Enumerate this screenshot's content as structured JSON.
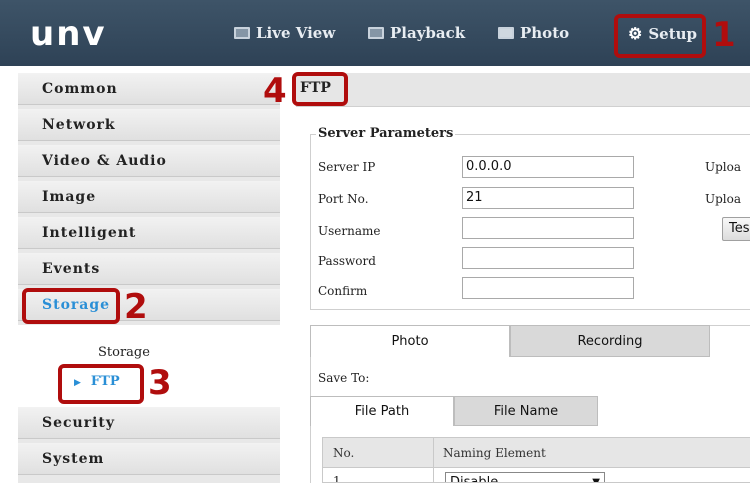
{
  "nav": {
    "logo": "unv",
    "items": [
      {
        "label": "Live View",
        "icon": "monitor-icon"
      },
      {
        "label": "Playback",
        "icon": "film-icon"
      },
      {
        "label": "Photo",
        "icon": "image-icon"
      },
      {
        "label": "Setup",
        "icon": "gear-icon"
      }
    ]
  },
  "annotations": [
    "1",
    "2",
    "3",
    "4"
  ],
  "sidebar": {
    "items": [
      "Common",
      "Network",
      "Video & Audio",
      "Image",
      "Intelligent",
      "Events",
      "Storage",
      "Security",
      "System"
    ],
    "sub_items": [
      "Storage",
      "FTP"
    ]
  },
  "main": {
    "title": "FTP",
    "server_params": {
      "legend": "Server Parameters",
      "fields": [
        {
          "label": "Server IP",
          "value": "0.0.0.0"
        },
        {
          "label": "Port No.",
          "value": "21"
        },
        {
          "label": "Username",
          "value": ""
        },
        {
          "label": "Password",
          "value": ""
        },
        {
          "label": "Confirm",
          "value": ""
        }
      ],
      "right_labels": [
        "Uploa",
        "Uploa"
      ],
      "test_button": "Tes"
    },
    "tabs": [
      "Photo",
      "Recording"
    ],
    "save_to": "Save To:",
    "subtabs": [
      "File Path",
      "File Name"
    ],
    "table": {
      "headers": [
        "No.",
        "Naming Element"
      ],
      "row": {
        "no": "1",
        "element": "Disable"
      }
    }
  },
  "colors": {
    "accent": "#2a8fd6",
    "annotation": "#b00d0d",
    "topbar": "#354a5f"
  }
}
